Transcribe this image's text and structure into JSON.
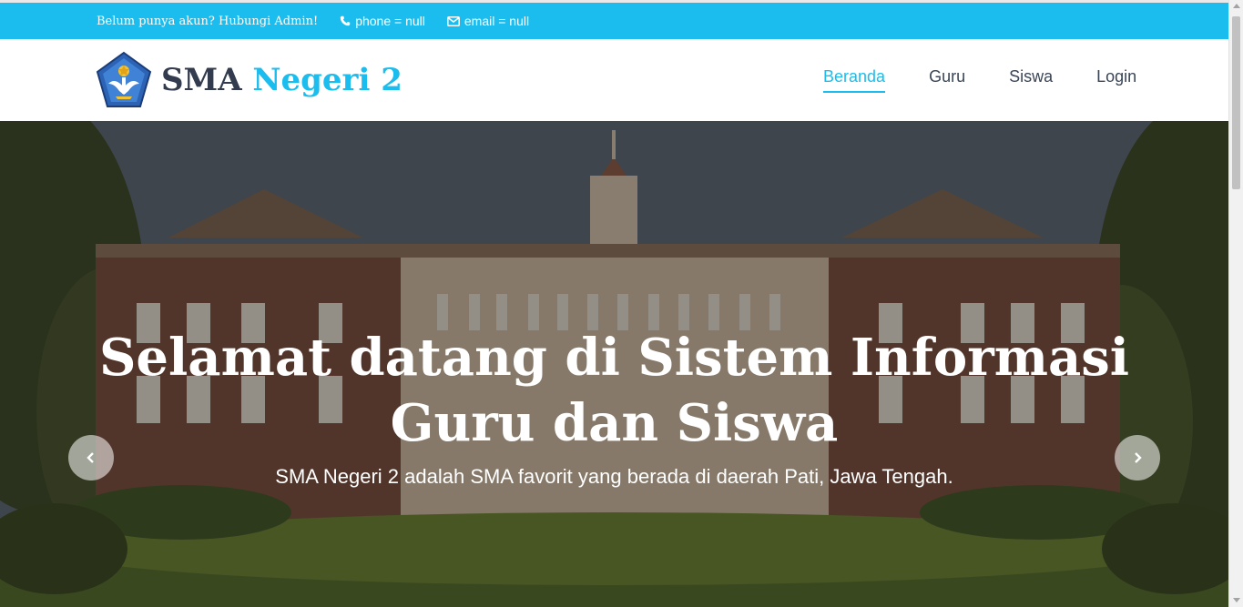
{
  "topbar": {
    "hint": "Belum punya akun? Hubungi Admin!",
    "phone": "phone = null",
    "email": "email = null",
    "phone_icon": "phone-icon",
    "email_icon": "envelope-icon"
  },
  "brand": {
    "part1": "SMA",
    "part2": "Negeri 2",
    "logo_icon": "school-emblem-icon"
  },
  "nav": {
    "items": [
      {
        "label": "Beranda",
        "active": true
      },
      {
        "label": "Guru",
        "active": false
      },
      {
        "label": "Siswa",
        "active": false
      },
      {
        "label": "Login",
        "active": false
      }
    ]
  },
  "hero": {
    "title_line1": "Selamat datang di Sistem Informasi",
    "title_line2": "Guru dan Siswa",
    "subtitle": "SMA Negeri 2 adalah SMA favorit yang berada di daerah Pati, Jawa Tengah.",
    "prev_icon": "chevron-left-icon",
    "next_icon": "chevron-right-icon"
  },
  "colors": {
    "accent": "#1bbdee",
    "brand_dark": "#333c4e",
    "nav_text": "#3a4556"
  }
}
